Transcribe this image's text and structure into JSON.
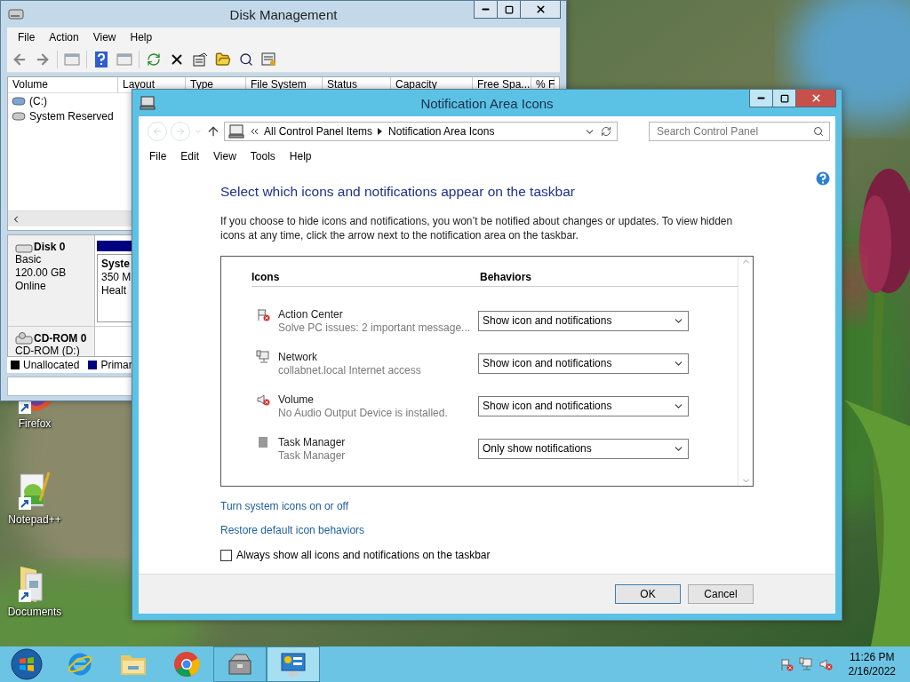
{
  "desktop": {
    "icons": [
      {
        "label": "Firefox",
        "kind": "firefox"
      },
      {
        "label": "Notepad++",
        "kind": "notepad"
      },
      {
        "label": "Documents",
        "kind": "folder"
      }
    ]
  },
  "disk_management": {
    "title": "Disk Management",
    "menu": [
      "File",
      "Action",
      "View",
      "Help"
    ],
    "columns": [
      "Volume",
      "Layout",
      "Type",
      "File System",
      "Status",
      "Capacity",
      "Free Spa...",
      "% F"
    ],
    "volumes": [
      {
        "name": "(C:)",
        "kind": "system"
      },
      {
        "name": "System Reserved",
        "kind": "reserved"
      }
    ],
    "disks": [
      {
        "name": "Disk 0",
        "kind": "disk",
        "lines": [
          "Basic",
          "120.00 GB",
          "Online"
        ],
        "partition": {
          "lines": [
            "Syste",
            "350 M",
            "Healt"
          ]
        }
      },
      {
        "name": "CD-ROM 0",
        "kind": "cdrom",
        "lines": [
          "CD-ROM (D:)"
        ]
      }
    ],
    "legend": [
      {
        "label": "Unallocated",
        "color": "#000000"
      },
      {
        "label": "Primar",
        "color": "#000080"
      }
    ]
  },
  "notification_window": {
    "title": "Notification Area Icons",
    "address": {
      "path": [
        "All Control Panel Items",
        "Notification Area Icons"
      ]
    },
    "search": {
      "placeholder": "Search Control Panel"
    },
    "menu": [
      "File",
      "Edit",
      "View",
      "Tools",
      "Help"
    ],
    "heading": "Select which icons and notifications appear on the taskbar",
    "description": "If you choose to hide icons and notifications, you won’t be notified about changes or updates. To view hidden icons at any time, click the arrow next to the notification area on the taskbar.",
    "table": {
      "columns": [
        "Icons",
        "Behaviors"
      ],
      "rows": [
        {
          "kind": "action_center",
          "name": "Action Center",
          "description": "Solve PC issues: 2 important message...",
          "behavior": "Show icon and notifications"
        },
        {
          "kind": "network",
          "name": "Network",
          "description": "collabnet.local Internet access",
          "behavior": "Show icon and notifications"
        },
        {
          "kind": "volume",
          "name": "Volume",
          "description": "No Audio Output Device is installed.",
          "behavior": "Show icon and notifications"
        },
        {
          "kind": "task_manager",
          "name": "Task Manager",
          "description": "Task Manager",
          "behavior": "Only show notifications"
        }
      ]
    },
    "links": [
      "Turn system icons on or off",
      "Restore default icon behaviors"
    ],
    "checkbox": {
      "label": "Always show all icons and notifications on the taskbar",
      "checked": false
    },
    "buttons": [
      "OK",
      "Cancel"
    ]
  },
  "taskbar": {
    "apps": [
      {
        "kind": "ie",
        "running": false,
        "selected": false
      },
      {
        "kind": "explorer",
        "running": false,
        "selected": false
      },
      {
        "kind": "chrome",
        "running": false,
        "selected": false
      },
      {
        "kind": "server_manager",
        "running": true,
        "selected": false
      },
      {
        "kind": "control_panel",
        "running": true,
        "selected": true
      }
    ],
    "tray": [
      {
        "kind": "action_center"
      },
      {
        "kind": "network"
      },
      {
        "kind": "volume"
      }
    ],
    "clock": {
      "time": "11:26 PM",
      "date": "2/16/2022"
    }
  }
}
